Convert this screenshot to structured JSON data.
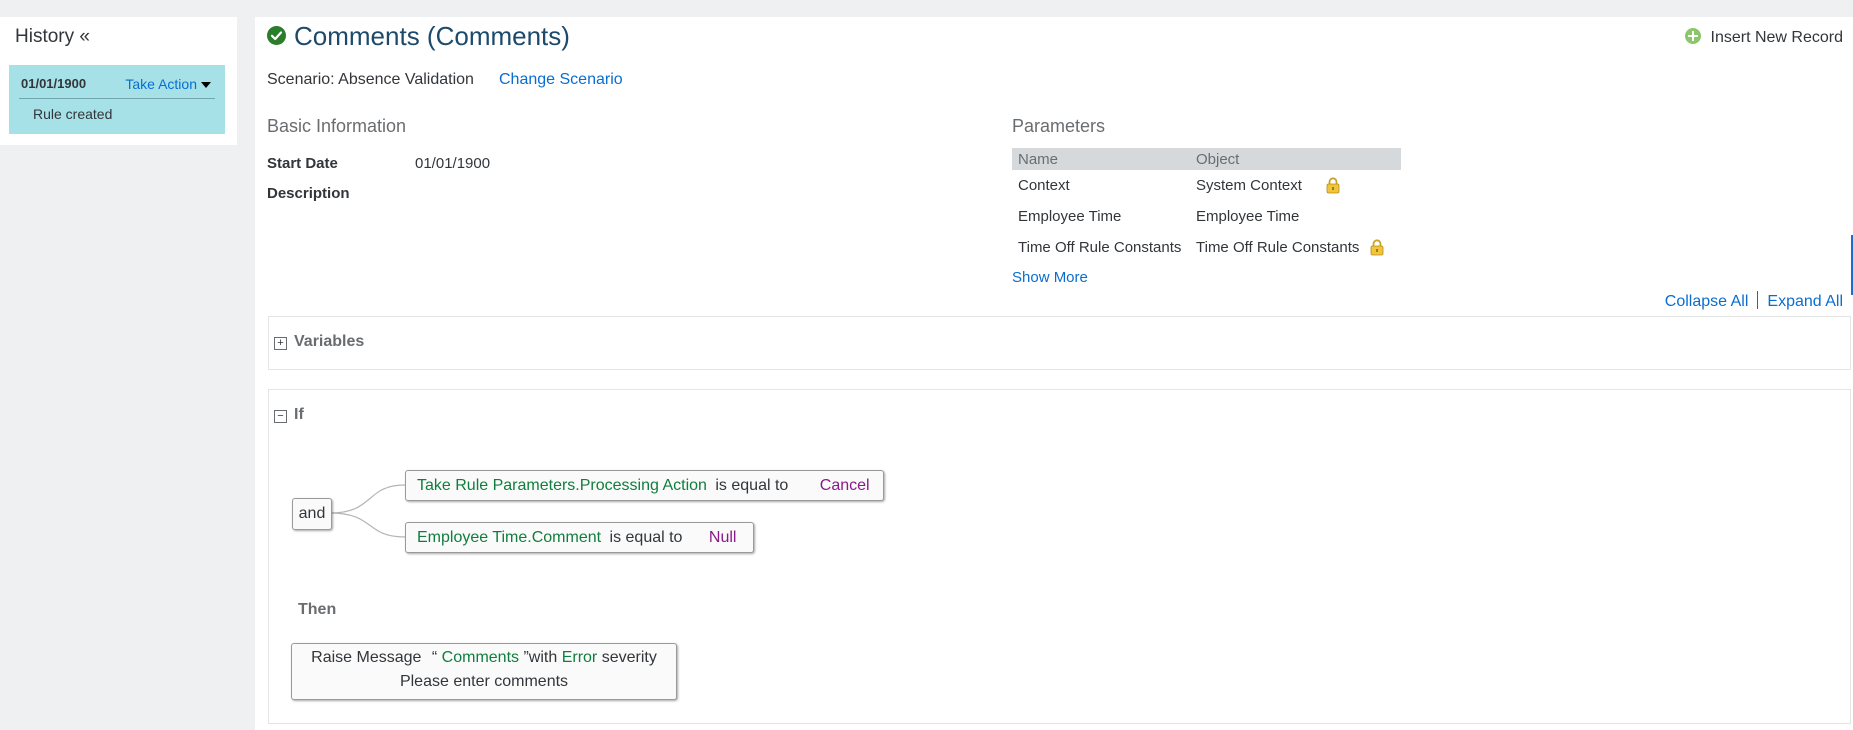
{
  "history": {
    "title": "History «",
    "entry": {
      "date": "01/01/1900",
      "action_label": "Take Action",
      "note": "Rule created"
    }
  },
  "header": {
    "title": "Comments (Comments)",
    "insert_label": "Insert New Record",
    "scenario_text": "Scenario: Absence Validation",
    "change_scenario_label": "Change Scenario"
  },
  "basic_info": {
    "heading": "Basic Information",
    "start_date_label": "Start Date",
    "start_date_value": "01/01/1900",
    "description_label": "Description"
  },
  "parameters": {
    "heading": "Parameters",
    "columns": [
      "Name",
      "Object"
    ],
    "rows": [
      {
        "name": "Context",
        "object": "System Context",
        "locked": true
      },
      {
        "name": "Employee Time",
        "object": "Employee Time",
        "locked": false
      },
      {
        "name": "Time Off Rule Constants",
        "object": "Time Off Rule Constants",
        "locked": true
      }
    ],
    "show_more_label": "Show More"
  },
  "controls": {
    "collapse_all": "Collapse All",
    "expand_all": "Expand All"
  },
  "variables": {
    "title": "Variables",
    "toggle": "+"
  },
  "if_block": {
    "title": "If",
    "toggle": "−",
    "operator": "and",
    "conditions": [
      {
        "field": "Take Rule Parameters.Processing Action",
        "op": "is equal to",
        "value": "Cancel"
      },
      {
        "field": "Employee Time.Comment",
        "op": "is equal to",
        "value": "Null"
      }
    ]
  },
  "then_block": {
    "title": "Then",
    "action": {
      "verb": "Raise Message",
      "open_quote": "“",
      "message_key": "Comments",
      "close_quote": "”",
      "with": "with",
      "severity": "Error",
      "severity_word": "severity",
      "message_text": "Please enter comments"
    }
  },
  "colors": {
    "accent_link": "#0a6ed1",
    "history_entry_bg": "#a5e1e7",
    "green_token": "#107e3e",
    "purple_token": "#8b1a8b",
    "title_color": "#1d4a6b"
  }
}
